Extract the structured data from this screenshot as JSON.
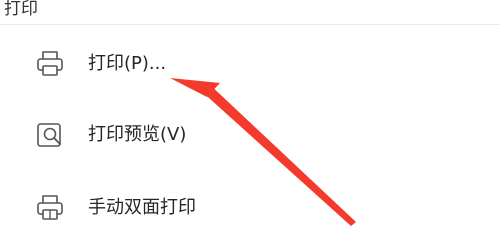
{
  "section": {
    "title": "打印"
  },
  "menu": {
    "items": [
      {
        "label": "打印(P)...",
        "icon": "printer-icon"
      },
      {
        "label": "打印预览(V)",
        "icon": "print-preview-icon"
      },
      {
        "label": "手动双面打印",
        "icon": "duplex-print-icon"
      }
    ]
  },
  "annotation": {
    "arrow_color": "#f43a2c"
  }
}
